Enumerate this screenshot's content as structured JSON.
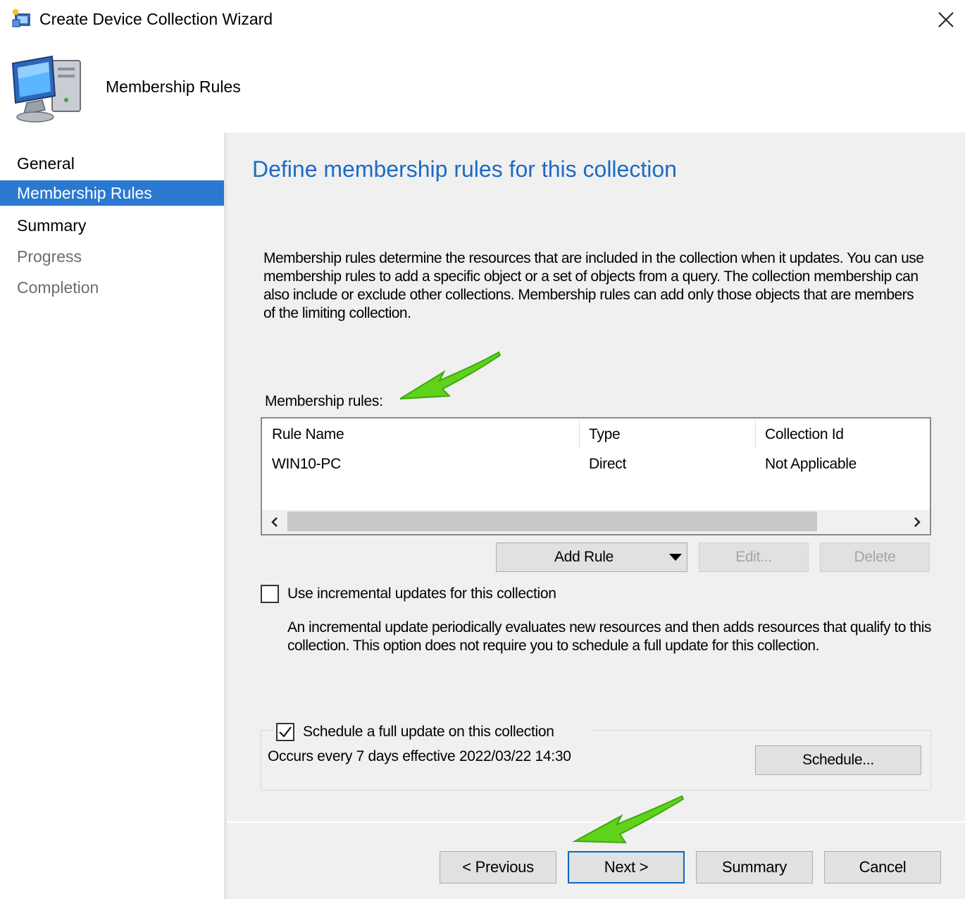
{
  "window": {
    "title": "Create Device Collection Wizard",
    "close_symbol": "✕"
  },
  "header": {
    "title": "Membership Rules"
  },
  "sidebar": {
    "items": [
      {
        "label": "General",
        "state": "normal"
      },
      {
        "label": "Membership Rules",
        "state": "active"
      },
      {
        "label": "Summary",
        "state": "normal"
      },
      {
        "label": "Progress",
        "state": "disabled"
      },
      {
        "label": "Completion",
        "state": "disabled"
      }
    ]
  },
  "main": {
    "title": "Define membership rules for this collection",
    "description": "Membership rules determine the resources that are included in the collection when it updates. You can use membership rules to add a specific object or a set of objects from a query. The collection membership can also include or exclude other collections. Membership rules can add only those objects that are members of the limiting collection.",
    "rules_label": "Membership rules:",
    "table": {
      "columns": [
        "Rule Name",
        "Type",
        "Collection Id"
      ],
      "rows": [
        [
          "WIN10-PC",
          "Direct",
          "Not Applicable"
        ]
      ]
    },
    "buttons": {
      "add_rule": "Add Rule",
      "edit": "Edit...",
      "delete": "Delete"
    },
    "incremental": {
      "label": "Use incremental updates for this collection",
      "checked": false,
      "description": "An incremental update periodically evaluates new resources and then adds resources that qualify to this collection. This option does not require you to schedule a full update for this collection."
    },
    "schedule": {
      "label": "Schedule a full update on this collection",
      "checked": true,
      "occurs": "Occurs every 7 days effective 2022/03/22 14:30",
      "button": "Schedule..."
    }
  },
  "footer": {
    "previous": "< Previous",
    "next": "Next >",
    "summary": "Summary",
    "cancel": "Cancel"
  },
  "colors": {
    "accent": "#2b78d0",
    "title_blue": "#1c6bc5",
    "arrow_green": "#5fd21c"
  }
}
